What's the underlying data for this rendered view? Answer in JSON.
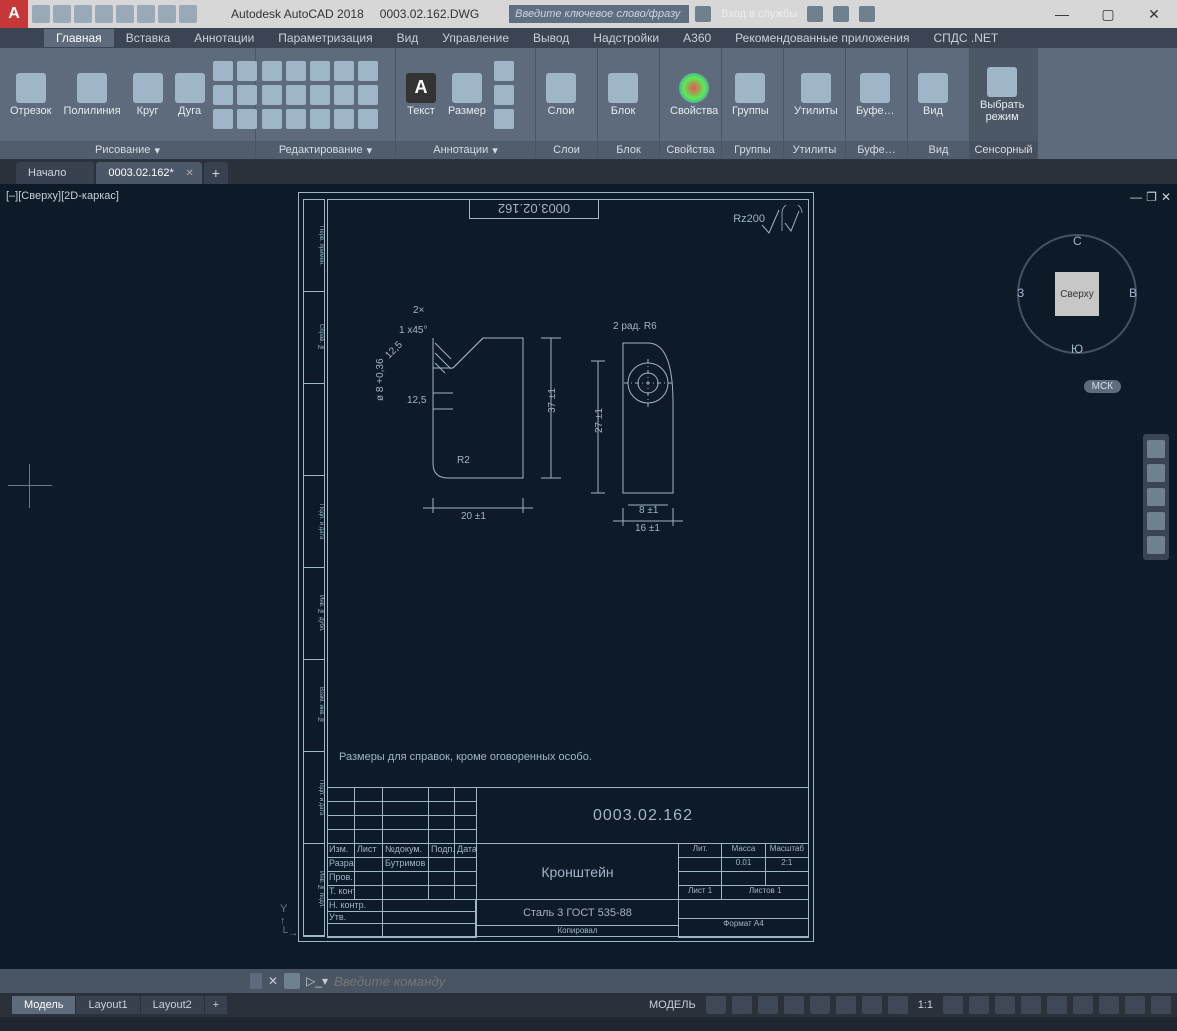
{
  "titlebar": {
    "app": "Autodesk AutoCAD 2018",
    "file": "0003.02.162.DWG",
    "search_placeholder": "Введите ключевое слово/фразу",
    "signin": "Вход в службы"
  },
  "ribbon_tabs": [
    "Главная",
    "Вставка",
    "Аннотации",
    "Параметризация",
    "Вид",
    "Управление",
    "Вывод",
    "Надстройки",
    "A360",
    "Рекомендованные приложения",
    "СПДС .NET"
  ],
  "ribbon_active": 0,
  "panels": {
    "draw": {
      "title": "Рисование",
      "btns": [
        "Отрезок",
        "Полилиния",
        "Круг",
        "Дуга"
      ]
    },
    "edit": {
      "title": "Редактирование"
    },
    "anno": {
      "title": "Аннотации",
      "btns": [
        "Текст",
        "Размер"
      ]
    },
    "layers": {
      "title": "Слои"
    },
    "block": {
      "title": "Блок"
    },
    "props": {
      "title": "Свойства"
    },
    "groups": {
      "title": "Группы"
    },
    "utils": {
      "title": "Утилиты"
    },
    "clip": {
      "title": "Буфе…"
    },
    "view": {
      "title": "Вид"
    },
    "touch": {
      "title": "Сенсорный",
      "btn": "Выбрать\nрежим"
    }
  },
  "filetabs": {
    "home": "Начало",
    "doc": "0003.02.162*"
  },
  "viewport": {
    "label": "[–][Сверху][2D-каркас]"
  },
  "viewcube": {
    "face": "Сверху",
    "n": "С",
    "s": "Ю",
    "e": "В",
    "w": "З",
    "wcs": "МСК"
  },
  "drawing": {
    "number": "0003.02.162",
    "number_mirror": "0003.02.162",
    "rz": "Rz200",
    "note": "Размеры для справок, кроме оговоренных особо.",
    "title": "Кронштейн",
    "material": "Сталь 3 ГОСТ 535-88",
    "dims": {
      "d1": "2×",
      "d2": "1 x45°",
      "d3": "12,5",
      "d4": "12,5",
      "d5": "ø 8 +0,36",
      "d6": "R2",
      "d7": "20 ±1",
      "d8": "37 ±1",
      "d9": "2 рад. R6",
      "d10": "27 ±1",
      "d11": "8 ±1",
      "d12": "16 ±1"
    },
    "tb": {
      "h1": "Изм.",
      "h2": "Лист",
      "h3": "№докум.",
      "h4": "Подп.",
      "h5": "Дата",
      "r1": "Разраб.",
      "r1v": "Бутримов",
      "r2": "Пров.",
      "r3": "Т. контр.",
      "r4": "Н. контр.",
      "r5": "Утв.",
      "lit": "Лит.",
      "mass": "Масса",
      "scale": "Масштаб",
      "massv": "0.01",
      "scalev": "2:1",
      "sheet": "Лист 1",
      "sheets": "Листов 1",
      "copy": "Копировал",
      "fmt": "Формат  A4"
    }
  },
  "cmdline": {
    "placeholder": "Введите команду"
  },
  "layouts": [
    "Модель",
    "Layout1",
    "Layout2"
  ],
  "status": {
    "model": "МОДЕЛЬ",
    "scale": "1:1"
  }
}
